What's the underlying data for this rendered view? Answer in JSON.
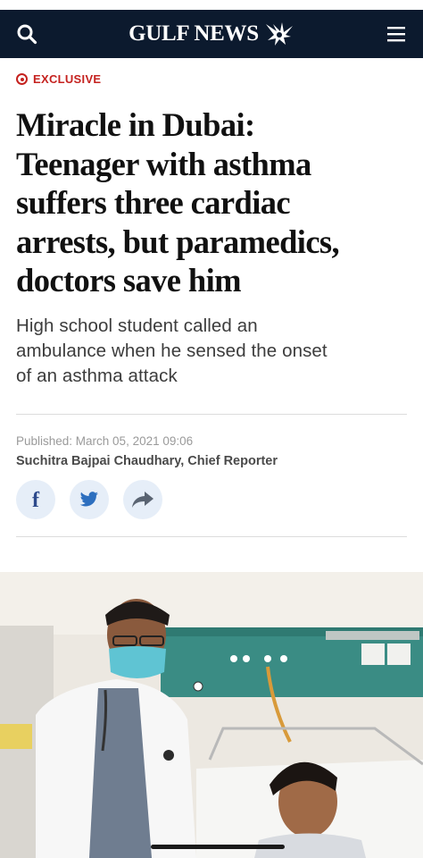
{
  "header": {
    "brand": "GULF NEWS",
    "icons": {
      "left": "search-icon",
      "right": "hamburger-menu-icon",
      "logo": "falcon-logo-icon"
    },
    "background": "#0c1a2e"
  },
  "article": {
    "kicker": "EXCLUSIVE",
    "kicker_color": "#c5221f",
    "headline_lines": [
      "Miracle in Dubai:",
      "Teenager with asthma",
      "suffers three cardiac",
      "arrests, but paramedics,",
      "doctors save him"
    ],
    "subhead_lines": [
      "High school student called an",
      "ambulance when he sensed the onset",
      "of an asthma attack"
    ],
    "published": "Published:  March 05, 2021 09:06",
    "author": "Suchitra Bajpai Chaudhary, Chief Reporter"
  },
  "share": {
    "buttons": [
      "facebook-icon",
      "twitter-icon",
      "share-arrow-icon"
    ]
  },
  "photo": {
    "icon": "article-photo"
  }
}
